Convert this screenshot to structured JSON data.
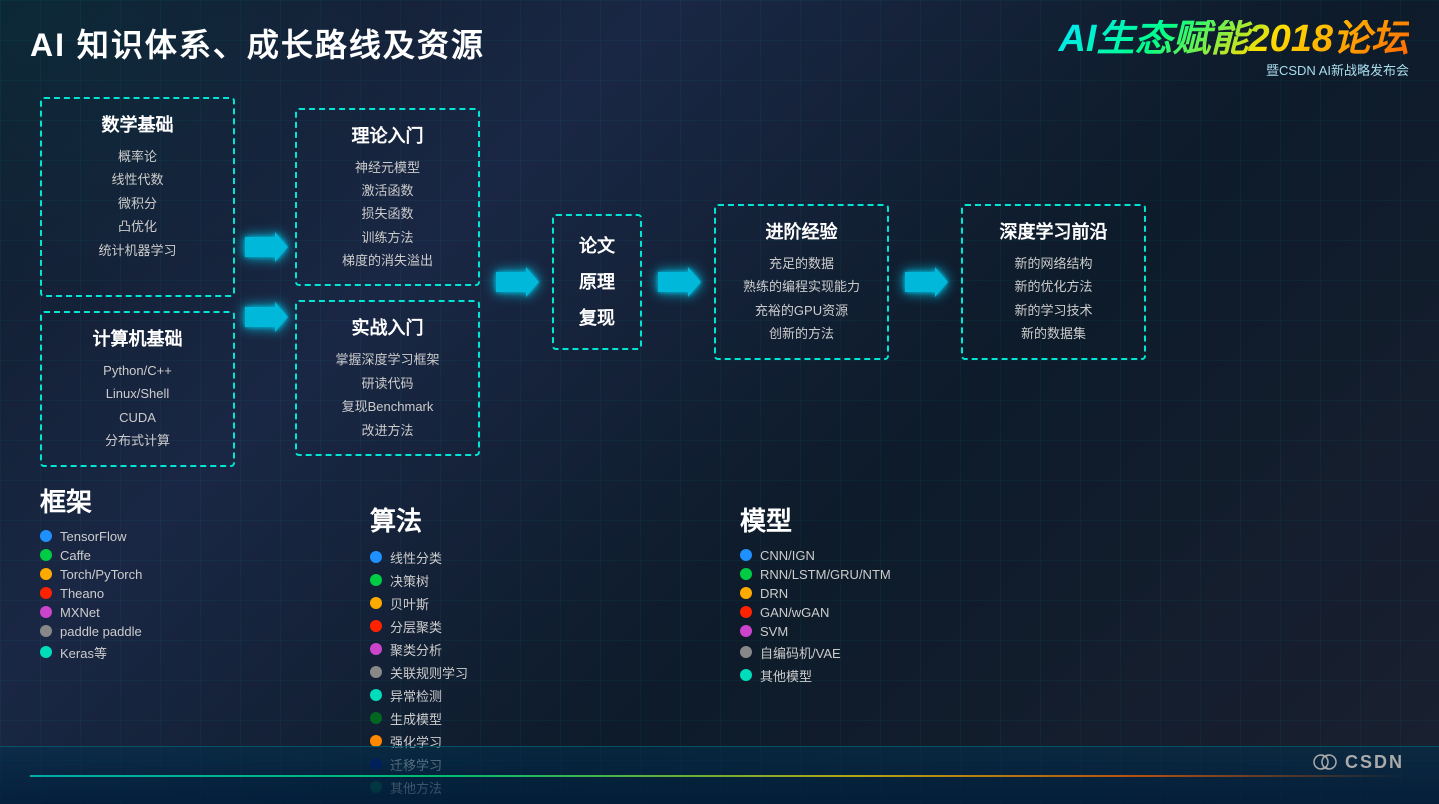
{
  "header": {
    "title": "AI 知识体系、成长路线及资源",
    "logo_main": "AI生态赋能2018论坛",
    "logo_sub": "暨CSDN AI新战略发布会"
  },
  "flow": {
    "math_box": {
      "title": "数学基础",
      "items": [
        "概率论",
        "线性代数",
        "微积分",
        "凸优化",
        "统计机器学习"
      ]
    },
    "computer_box": {
      "title": "计算机基础",
      "items": [
        "Python/C++",
        "Linux/Shell",
        "CUDA",
        "分布式计算"
      ]
    },
    "theory_box": {
      "title": "理论入门",
      "items": [
        "神经元模型",
        "激活函数",
        "损失函数",
        "训练方法",
        "梯度的消失溢出"
      ]
    },
    "practice_box": {
      "title": "实战入门",
      "items": [
        "掌握深度学习框架",
        "研读代码",
        "复现Benchmark",
        "改进方法"
      ]
    },
    "paper_box": {
      "lines": [
        "论文",
        "原理",
        "复现"
      ]
    },
    "advanced_box": {
      "title": "进阶经验",
      "items": [
        "充足的数据",
        "熟练的编程实现能力",
        "充裕的GPU资源",
        "创新的方法"
      ]
    },
    "deep_box": {
      "title": "深度学习前沿",
      "items": [
        "新的网络结构",
        "新的优化方法",
        "新的学习技术",
        "新的数据集"
      ]
    }
  },
  "frameworks": {
    "label": "框架",
    "items": [
      {
        "color": "#1e90ff",
        "text": "TensorFlow"
      },
      {
        "color": "#00cc44",
        "text": "Caffe"
      },
      {
        "color": "#ffaa00",
        "text": "Torch/PyTorch"
      },
      {
        "color": "#ff2200",
        "text": "Theano"
      },
      {
        "color": "#cc44cc",
        "text": "MXNet"
      },
      {
        "color": "#888888",
        "text": "paddle paddle"
      },
      {
        "color": "#00ddbb",
        "text": "Keras等"
      }
    ]
  },
  "algorithms": {
    "label": "算法",
    "items": [
      {
        "color": "#1e90ff",
        "text": "线性分类"
      },
      {
        "color": "#00cc44",
        "text": "决策树"
      },
      {
        "color": "#ffaa00",
        "text": "贝叶斯"
      },
      {
        "color": "#ff2200",
        "text": "分层聚类"
      },
      {
        "color": "#cc44cc",
        "text": "聚类分析"
      },
      {
        "color": "#888888",
        "text": "关联规则学习"
      },
      {
        "color": "#00ddbb",
        "text": "异常检测"
      },
      {
        "color": "#006622",
        "text": "生成模型"
      },
      {
        "color": "#ff8800",
        "text": "强化学习"
      },
      {
        "color": "#001177",
        "text": "迁移学习"
      },
      {
        "color": "#006644",
        "text": "其他方法"
      }
    ]
  },
  "models": {
    "label": "模型",
    "items": [
      {
        "color": "#1e90ff",
        "text": "CNN/IGN"
      },
      {
        "color": "#00cc44",
        "text": "RNN/LSTM/GRU/NTM"
      },
      {
        "color": "#ffaa00",
        "text": "DRN"
      },
      {
        "color": "#ff2200",
        "text": "GAN/wGAN"
      },
      {
        "color": "#cc44cc",
        "text": "SVM"
      },
      {
        "color": "#888888",
        "text": "自编码机/VAE"
      },
      {
        "color": "#00ddbb",
        "text": "其他模型"
      }
    ]
  },
  "csdn": {
    "text": "CSDN"
  }
}
